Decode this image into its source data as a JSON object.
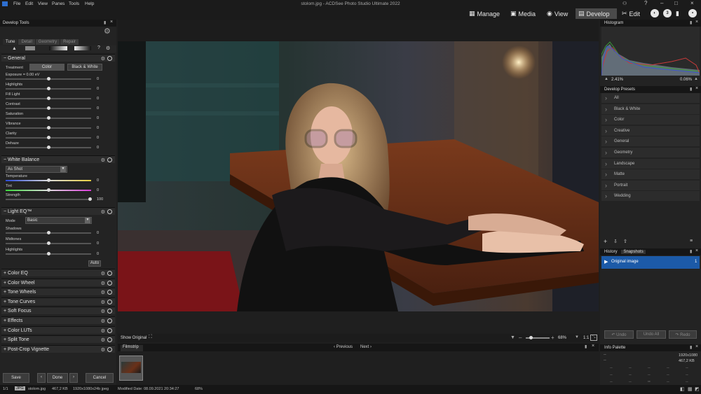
{
  "app": {
    "title": "stolom.jpg - ACDSee Photo Studio Ultimate 2022"
  },
  "menu": [
    "File",
    "Edit",
    "View",
    "Panes",
    "Tools",
    "Help"
  ],
  "modes": [
    {
      "label": "Manage"
    },
    {
      "label": "Media"
    },
    {
      "label": "View"
    },
    {
      "label": "Develop"
    },
    {
      "label": "Edit"
    }
  ],
  "left_panel": {
    "title": "Develop Tools",
    "tabs": [
      "Tune",
      "Detail",
      "Geometry",
      "Repair"
    ],
    "general": {
      "title": "General",
      "treatment_label": "Treatment",
      "color_btn": "Color",
      "bw_btn": "Black & White",
      "sliders": [
        {
          "label": "Exposure = 0.00 eV",
          "value": "0"
        },
        {
          "label": "Highlights",
          "value": "0"
        },
        {
          "label": "Fill Light",
          "value": "0"
        },
        {
          "label": "Contrast",
          "value": "0"
        },
        {
          "label": "Saturation",
          "value": "0"
        },
        {
          "label": "Vibrance",
          "value": "0"
        },
        {
          "label": "Clarity",
          "value": "0"
        },
        {
          "label": "Dehaze",
          "value": "0"
        }
      ]
    },
    "wb": {
      "title": "White Balance",
      "preset": "As Shot",
      "sliders": [
        {
          "label": "Temperature",
          "value": "0"
        },
        {
          "label": "Tint",
          "value": "0"
        },
        {
          "label": "Strength",
          "value": "100"
        }
      ]
    },
    "lighteq": {
      "title": "Light EQ™",
      "mode_label": "Mode",
      "mode": "Basic",
      "sliders": [
        {
          "label": "Shadows",
          "value": "0"
        },
        {
          "label": "Midtones",
          "value": "0"
        },
        {
          "label": "Highlights",
          "value": "0"
        }
      ],
      "auto": "Auto"
    },
    "collapsed": [
      "Color EQ",
      "Color Wheel",
      "Tone Wheels",
      "Tone Curves",
      "Soft Focus",
      "Effects",
      "Color LUTs",
      "Split Tone",
      "Post-Crop Vignette"
    ],
    "save": "Save",
    "done": "Done",
    "cancel": "Cancel"
  },
  "center": {
    "show_original": "Show Original",
    "zoom": "68%",
    "ratio": "1:1",
    "filmstrip": "Filmstrip",
    "previous": "Previous",
    "next": "Next"
  },
  "right_panel": {
    "histogram": {
      "title": "Histogram",
      "left_pct": "2.41%",
      "right_pct": "0.06%"
    },
    "presets": {
      "title": "Develop Presets",
      "items": [
        "All",
        "Black & White",
        "Color",
        "Creative",
        "General",
        "Geometry",
        "Landscape",
        "Matte",
        "Portrait",
        "Wedding"
      ]
    },
    "history": {
      "tab1": "History",
      "tab2": "Snapshots",
      "item": "Original image",
      "count": "1",
      "undo": "Undo",
      "undo_all": "Undo All",
      "redo": "Redo"
    },
    "info": {
      "title": "Info Palette",
      "dims": "1920x1080",
      "size": "467,2 KB",
      "dash": "--"
    }
  },
  "status": {
    "count": "1/1",
    "badge": "JPG",
    "file": "stolom.jpg",
    "size": "467,2 KB",
    "info": "1920x1080x24b jpeg",
    "modified": "Modified Date: 08.09.2021 20:34:27",
    "zoom": "68%"
  }
}
